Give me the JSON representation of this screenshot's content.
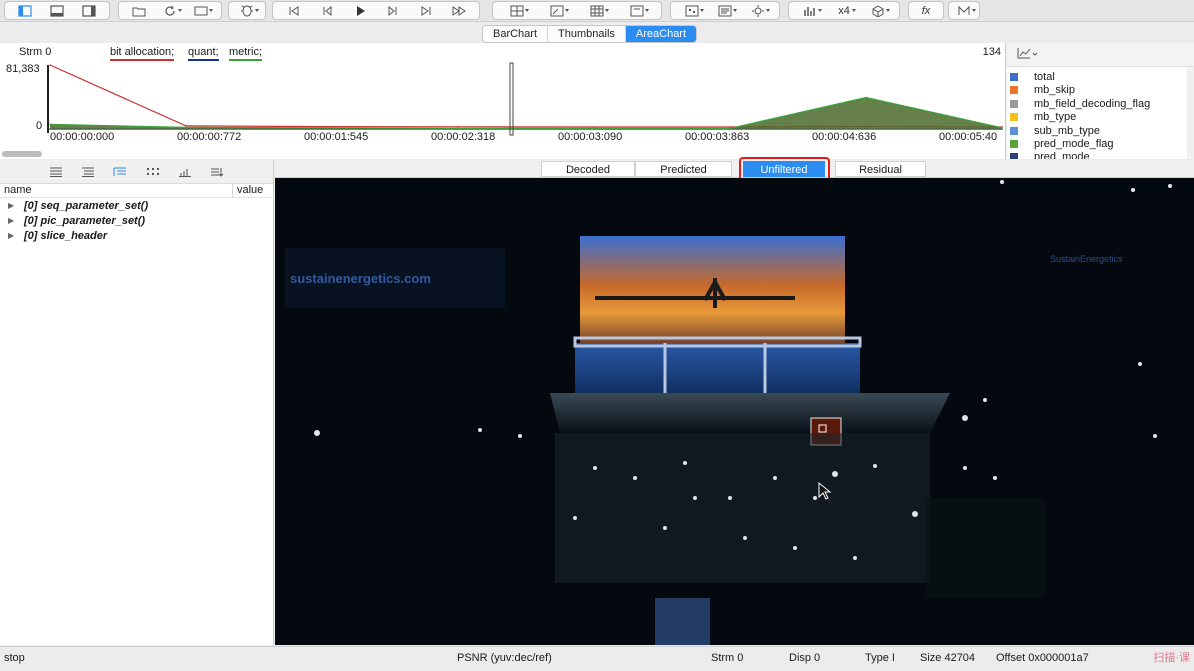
{
  "toolbar": {
    "zoom_label": "x4",
    "fx_label": "fx"
  },
  "chart_tabs": [
    "BarChart",
    "Thumbnails",
    "AreaChart"
  ],
  "chart_tabs_active": "AreaChart",
  "chart": {
    "stream_label": "Strm 0",
    "legend": [
      {
        "label": "bit allocation;",
        "color": "#d32f2f"
      },
      {
        "label": "quant;",
        "color": "#1a2f9e"
      },
      {
        "label": "metric;",
        "color": "#3aa33a"
      }
    ],
    "frame_count": "134",
    "y_max": "81,383",
    "y_zero": "0",
    "time_ticks": [
      "00:00:00:000",
      "00:00:00:772",
      "00:00:01:545",
      "00:00:02:318",
      "00:00:03:090",
      "00:00:03:863",
      "00:00:04:636",
      "00:00:05:40"
    ]
  },
  "chart_data": {
    "type": "area",
    "title": "",
    "xlabel": "",
    "ylabel": "",
    "ylim": [
      0,
      81383
    ],
    "x": [
      "00:00:00:000",
      "00:00:00:772",
      "00:00:01:545",
      "00:00:02:318",
      "00:00:03:090",
      "00:00:03:863",
      "00:00:04:636",
      "00:00:05:40"
    ],
    "series": [
      {
        "name": "bit allocation",
        "color": "#d32f2f",
        "values": [
          81383,
          4000,
          3000,
          2800,
          2600,
          2600,
          3000,
          2600
        ]
      },
      {
        "name": "quant",
        "color": "#1a2f9e",
        "values": [
          0,
          0,
          0,
          0,
          0,
          0,
          0,
          0
        ]
      },
      {
        "name": "metric",
        "color": "#3aa33a",
        "values": [
          6000,
          2000,
          1500,
          800,
          700,
          700,
          40000,
          1500
        ]
      }
    ]
  },
  "legend_panel": {
    "items": [
      {
        "label": "total",
        "color": "#3d6fc8"
      },
      {
        "label": "mb_skip",
        "color": "#e8762b"
      },
      {
        "label": "mb_field_decoding_flag",
        "color": "#9a9a9a"
      },
      {
        "label": "mb_type",
        "color": "#f2c21a"
      },
      {
        "label": "sub_mb_type",
        "color": "#5b8fd6"
      },
      {
        "label": "pred_mode_flag",
        "color": "#5aa53a"
      },
      {
        "label": "pred_mode",
        "color": "#2a3f7a"
      }
    ]
  },
  "tree": {
    "col_name": "name",
    "col_value": "value",
    "rows": [
      "[0] seq_parameter_set()",
      "[0] pic_parameter_set()",
      "[0] slice_header"
    ]
  },
  "view_tabs": [
    "Decoded",
    "Predicted",
    "Unfiltered",
    "Residual"
  ],
  "view_tabs_active": "Unfiltered",
  "status": {
    "state": "stop",
    "psnr": "PSNR (yuv:dec/ref)",
    "strm": "Strm 0",
    "disp": "Disp 0",
    "type": "Type I",
    "size": "Size 42704",
    "offset": "Offset 0x000001a7",
    "watermark": "扫描·课"
  }
}
